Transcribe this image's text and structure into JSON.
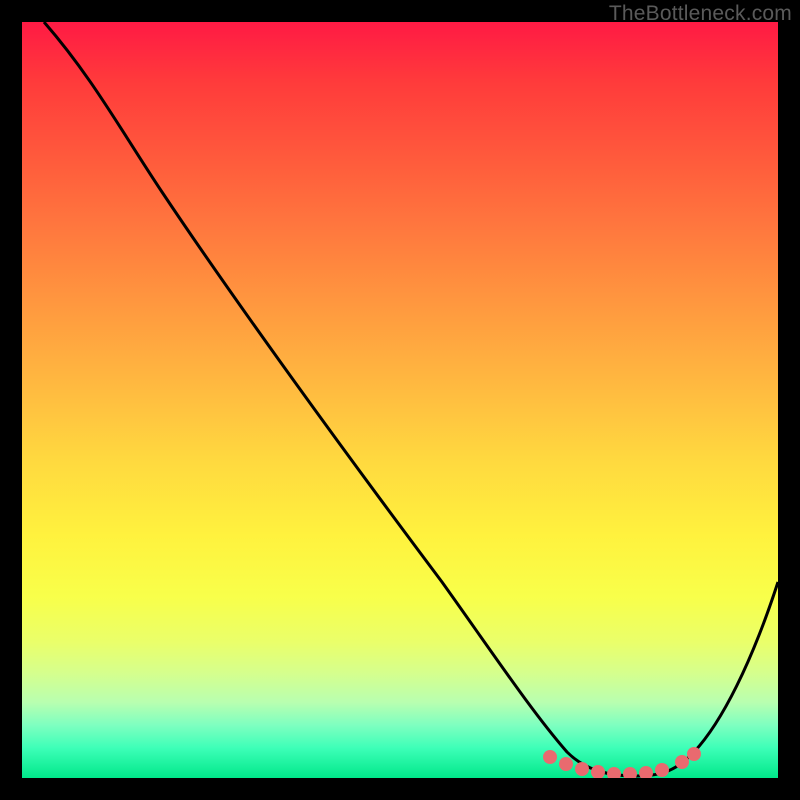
{
  "watermark": "TheBottleneck.com",
  "chart_data": {
    "type": "line",
    "title": "",
    "xlabel": "",
    "ylabel": "",
    "xlim": [
      0,
      100
    ],
    "ylim": [
      0,
      100
    ],
    "series": [
      {
        "name": "curve",
        "x": [
          3,
          10,
          18,
          30,
          45,
          60,
          66,
          70,
          74,
          78,
          82,
          85,
          90,
          95,
          100
        ],
        "y": [
          100,
          92,
          83,
          67,
          47,
          27,
          18,
          12,
          6,
          3,
          1,
          1,
          5,
          15,
          28
        ]
      }
    ],
    "highlight_points": {
      "name": "optimal-range",
      "x": [
        66,
        69,
        72,
        75,
        78,
        80,
        82,
        84,
        86,
        87
      ],
      "y": [
        3.2,
        2.4,
        1.8,
        1.4,
        1.2,
        1.2,
        1.4,
        1.8,
        2.6,
        3.4
      ]
    },
    "colors": {
      "curve": "#000000",
      "highlight": "#e96a6f"
    }
  }
}
